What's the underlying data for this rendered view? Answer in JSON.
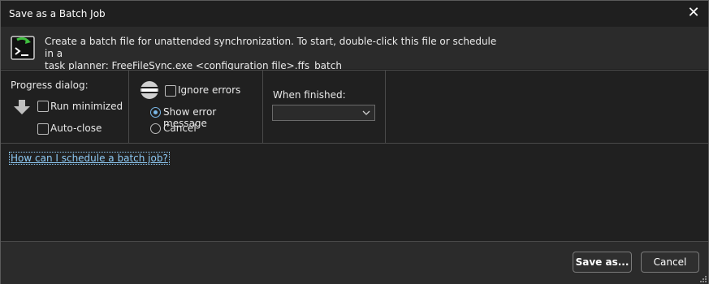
{
  "window": {
    "title": "Save as a Batch Job",
    "close_symbol": "✕"
  },
  "header": {
    "icon": "batch-terminal-icon",
    "description_line1": "Create a batch file for unattended synchronization. To start, double-click this file or schedule in a",
    "description_line2": "task planner: FreeFileSync.exe <configuration file>.ffs_batch"
  },
  "progress_dialog": {
    "title": "Progress dialog:",
    "run_minimized": {
      "label": "Run minimized",
      "checked": false
    },
    "auto_close": {
      "label": "Auto-close",
      "checked": false
    }
  },
  "errors": {
    "ignore_errors": {
      "label": "Ignore errors",
      "checked": false
    },
    "show_error_message": {
      "label": "Show error message",
      "selected": true
    },
    "cancel": {
      "label": "Cancel",
      "selected": false
    }
  },
  "when_finished": {
    "title": "When finished:",
    "value": ""
  },
  "help_link": "How can I schedule a batch job?",
  "buttons": {
    "save_as": "Save as...",
    "cancel": "Cancel"
  },
  "colors": {
    "background": "#202020",
    "panel": "#2b2b2b",
    "link": "#8ecaf5",
    "accent": "#7ab8e8"
  }
}
